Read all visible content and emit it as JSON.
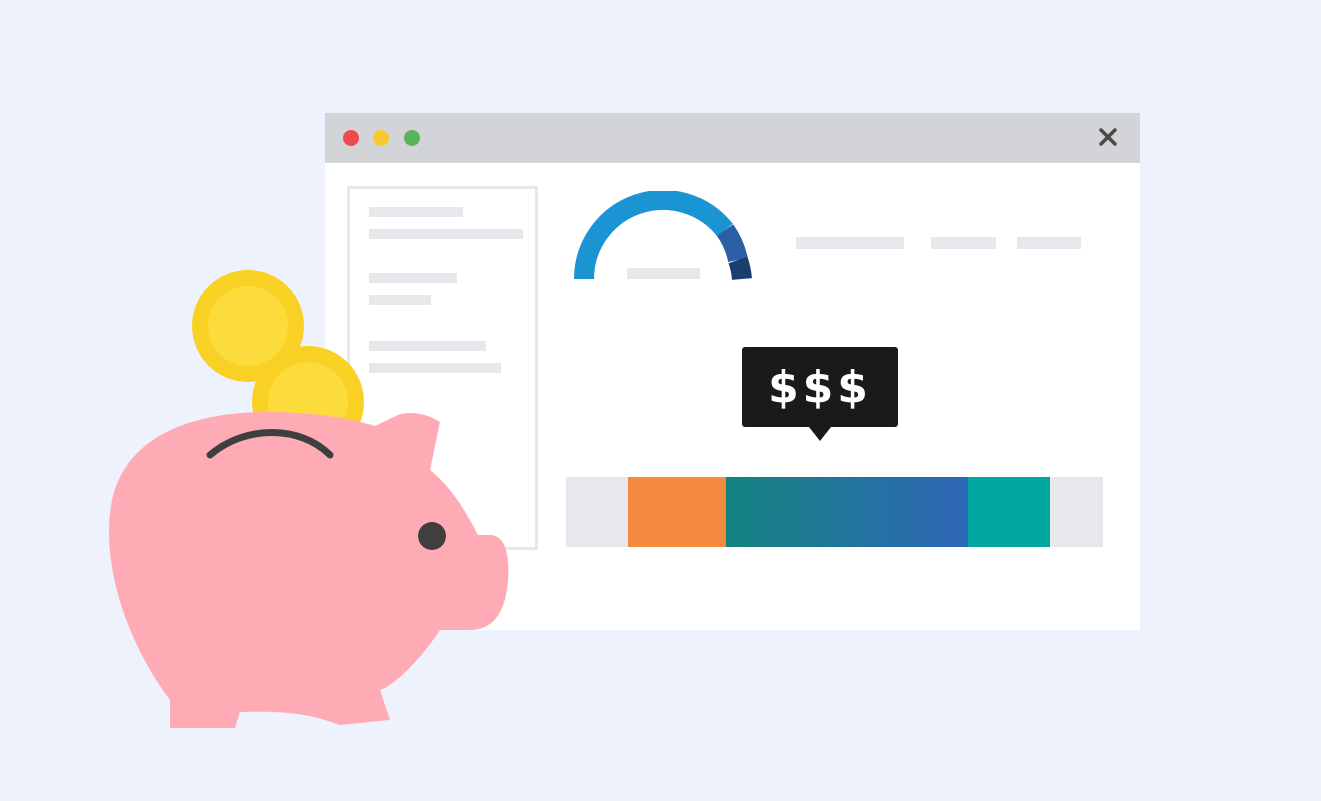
{
  "tooltip": {
    "text": "$$$"
  },
  "colors": {
    "background": "#eef2fc",
    "titlebar": "#d3d4d8",
    "dot_red": "#f04a4e",
    "dot_yellow": "#f8c92c",
    "dot_green": "#5ab55a",
    "gauge_main": "#1b94d3",
    "gauge_mid": "#2a5fa6",
    "gauge_end": "#1c3d70",
    "bar_orange": "#f58a41",
    "bar_gradient_start": "#14837f",
    "bar_gradient_end": "#2f67b8",
    "bar_teal": "#00a79e",
    "placeholder": "#e7e8eb",
    "pig": "#ffabb5",
    "coin": "#f8d124",
    "coin_inner": "#fbdc3c"
  },
  "icons": {
    "close": "close-icon",
    "gauge": "gauge-icon",
    "piggy_bank": "piggy-bank-icon",
    "coin": "coin-icon"
  },
  "gauge": {
    "value_fraction": 0.85
  },
  "bar_segments": [
    {
      "name": "orange",
      "fraction": 0.183
    },
    {
      "name": "blue-gradient",
      "fraction": 0.451
    },
    {
      "name": "teal",
      "fraction": 0.153
    }
  ]
}
